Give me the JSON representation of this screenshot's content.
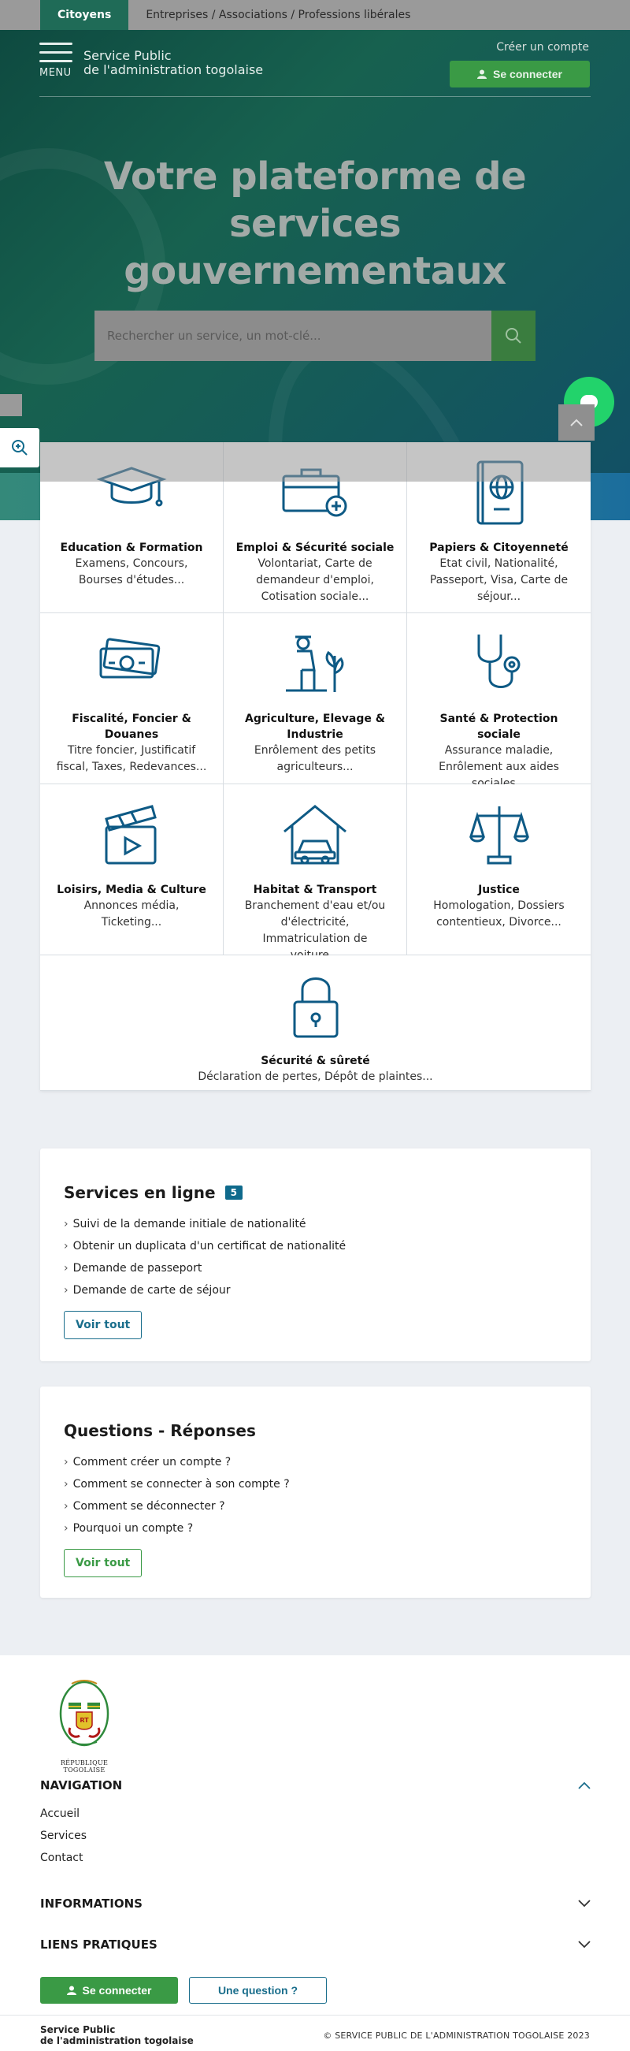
{
  "topbar": {
    "tabs": [
      {
        "label": "Citoyens",
        "active": true
      },
      {
        "label": "Entreprises / Associations / Professions libérales",
        "active": false
      }
    ]
  },
  "header": {
    "menu_label": "MENU",
    "brand_line1": "Service Public",
    "brand_line2": "de l'administration togolaise",
    "create_account": "Créer un compte",
    "login": "Se connecter"
  },
  "hero": {
    "title": "Votre plateforme de services gouvernementaux",
    "search_placeholder": "Rechercher un service, un mot-clé..."
  },
  "categories": [
    {
      "icon": "graduation-cap-icon",
      "title": "Education & Formation",
      "desc": "Examens, Concours, Bourses d'études..."
    },
    {
      "icon": "briefcase-icon",
      "title": "Emploi & Sécurité sociale",
      "desc": "Volontariat, Carte de demandeur d'emploi, Cotisation sociale..."
    },
    {
      "icon": "passport-icon",
      "title": "Papiers & Citoyenneté",
      "desc": "Etat civil, Nationalité, Passeport, Visa, Carte de séjour..."
    },
    {
      "icon": "money-icon",
      "title": "Fiscalité, Foncier & Douanes",
      "desc": "Titre foncier, Justificatif fiscal, Taxes, Redevances..."
    },
    {
      "icon": "farmer-icon",
      "title": "Agriculture, Elevage & Industrie",
      "desc": "Enrôlement des petits agriculteurs..."
    },
    {
      "icon": "stethoscope-icon",
      "title": "Santé & Protection sociale",
      "desc": "Assurance maladie, Enrôlement aux aides sociales..."
    },
    {
      "icon": "clapperboard-icon",
      "title": "Loisirs, Media & Culture",
      "desc": "Annonces média, Ticketing..."
    },
    {
      "icon": "house-car-icon",
      "title": "Habitat & Transport",
      "desc": "Branchement d'eau et/ou d'électricité, Immatriculation de voiture..."
    },
    {
      "icon": "scales-icon",
      "title": "Justice",
      "desc": "Homologation, Dossiers contentieux, Divorce..."
    },
    {
      "icon": "padlock-icon",
      "title": "Sécurité & sûreté",
      "desc": "Déclaration de pertes, Dépôt de plaintes..."
    }
  ],
  "services": {
    "title": "Services en ligne",
    "count": "5",
    "items": [
      "Suivi de la demande initiale de nationalité",
      "Obtenir un duplicata d'un certificat de nationalité",
      "Demande de passeport",
      "Demande de carte de séjour"
    ],
    "see_all": "Voir tout"
  },
  "faq": {
    "title": "Questions - Réponses",
    "items": [
      "Comment créer un compte ?",
      "Comment se connecter à son compte ?",
      "Comment se déconnecter ?",
      "Pourquoi un compte ?"
    ],
    "see_all": "Voir tout"
  },
  "footer": {
    "logo_caption": "RÉPUBLIQUE TOGOLAISE",
    "logo_initials": "RT",
    "navigation_title": "NAVIGATION",
    "nav_links": [
      "Accueil",
      "Services",
      "Contact"
    ],
    "informations_title": "INFORMATIONS",
    "liens_title": "LIENS PRATIQUES",
    "login": "Se connecter",
    "question": "Une question ?",
    "brand_line1": "Service Public",
    "brand_line2": "de l'administration togolaise",
    "copyright": "© SERVICE PUBLIC DE L'ADMINISTRATION TOGOLAISE 2023"
  },
  "colors": {
    "primary_green": "#3a9a45",
    "primary_blue": "#0f6a8c",
    "icon_blue": "#0e5a85",
    "hero_dark": "#0e4a40"
  }
}
